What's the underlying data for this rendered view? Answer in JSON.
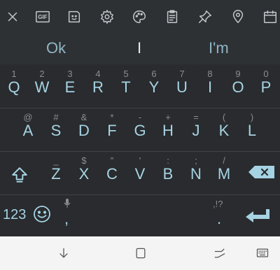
{
  "toolbar": {
    "icons": [
      "close-icon",
      "gif-icon",
      "sticker-icon",
      "settings-icon",
      "theme-palette-icon",
      "clipboard-icon",
      "pin-icon",
      "location-icon",
      "calendar-icon"
    ],
    "gif_label": "GIF"
  },
  "suggestions": [
    "Ok",
    "I",
    "I'm"
  ],
  "rows": [
    [
      [
        "1",
        "Q"
      ],
      [
        "2",
        "W"
      ],
      [
        "3",
        "E"
      ],
      [
        "4",
        "R"
      ],
      [
        "5",
        "T"
      ],
      [
        "6",
        "Y"
      ],
      [
        "7",
        "U"
      ],
      [
        "8",
        "I"
      ],
      [
        "9",
        "O"
      ],
      [
        "0",
        "P"
      ]
    ],
    [
      [
        "@",
        "A"
      ],
      [
        "#",
        "S"
      ],
      [
        "&",
        "D"
      ],
      [
        "*",
        "F"
      ],
      [
        "-",
        "G"
      ],
      [
        "+",
        "H"
      ],
      [
        "=",
        "J"
      ],
      [
        "(",
        "K"
      ],
      [
        ")",
        "L"
      ]
    ],
    [
      [
        "_",
        "Z"
      ],
      [
        "$",
        "X"
      ],
      [
        "\"",
        "C"
      ],
      [
        "'",
        "V"
      ],
      [
        ":",
        "B"
      ],
      [
        ";",
        "N"
      ],
      [
        "/",
        "M"
      ]
    ]
  ],
  "bottom_row": {
    "numbers_label": "123",
    "comma": ",",
    "period_hint": ",!?",
    "period": "."
  },
  "navbar": {
    "icons": [
      "back-icon",
      "home-icon",
      "recents-icon",
      "keyboard-switch-icon"
    ]
  }
}
